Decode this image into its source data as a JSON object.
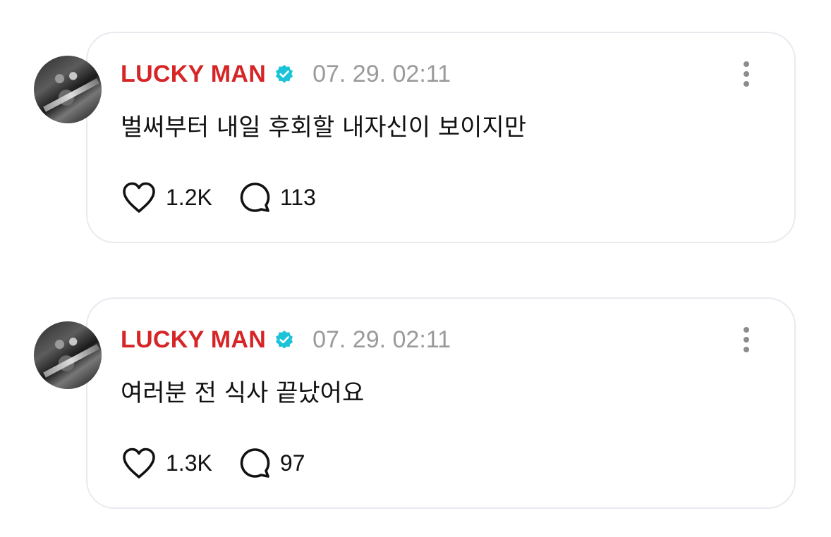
{
  "colors": {
    "username": "#d62527",
    "verified": "#1cc3d8",
    "timestamp": "#9a9a9a",
    "card_border": "#e9e9ef"
  },
  "posts": [
    {
      "username": "LUCKY MAN",
      "timestamp": "07. 29. 02:11",
      "text": "벌써부터 내일 후회할 내자신이 보이지만",
      "likes": "1.2K",
      "replies": "113",
      "icons": [
        "verified-badge-icon",
        "more-icon",
        "heart-icon",
        "comment-icon"
      ]
    },
    {
      "username": "LUCKY MAN",
      "timestamp": "07. 29. 02:11",
      "text": "여러분 전 식사 끝났어요",
      "likes": "1.3K",
      "replies": "97",
      "icons": [
        "verified-badge-icon",
        "more-icon",
        "heart-icon",
        "comment-icon"
      ]
    }
  ]
}
